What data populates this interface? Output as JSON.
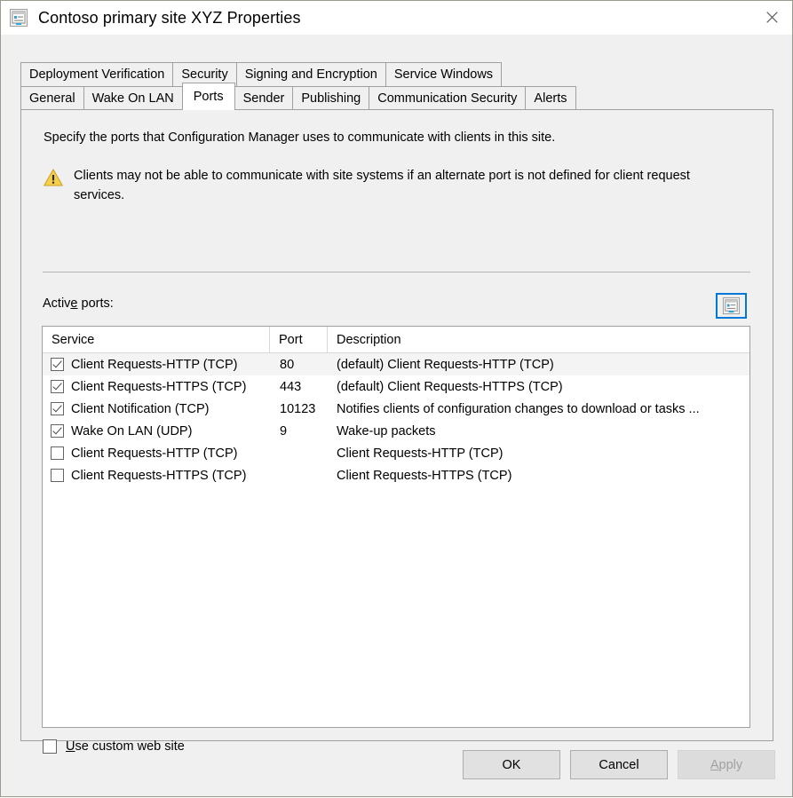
{
  "window": {
    "title": "Contoso primary site XYZ Properties",
    "title_icon": "properties-document-icon",
    "close_icon": "close-icon"
  },
  "tabs": {
    "row1": [
      {
        "label": "Deployment Verification",
        "selected": false
      },
      {
        "label": "Security",
        "selected": false
      },
      {
        "label": "Signing and Encryption",
        "selected": false
      },
      {
        "label": "Service Windows",
        "selected": false
      }
    ],
    "row2": [
      {
        "label": "General",
        "selected": false
      },
      {
        "label": "Wake On LAN",
        "selected": false
      },
      {
        "label": "Ports",
        "selected": true
      },
      {
        "label": "Sender",
        "selected": false
      },
      {
        "label": "Publishing",
        "selected": false
      },
      {
        "label": "Communication Security",
        "selected": false
      },
      {
        "label": "Alerts",
        "selected": false
      }
    ]
  },
  "panel": {
    "intro": "Specify the ports that Configuration Manager uses to communicate with clients in this site.",
    "warning_icon": "warning-triangle-icon",
    "warning": "Clients may not be able to communicate with site systems if an alternate port is not defined for client request services.",
    "active_ports_label_pre": "Activ",
    "active_ports_label_accel": "e",
    "active_ports_label_post": " ports:",
    "properties_button_icon": "properties-document-icon"
  },
  "listview": {
    "columns": [
      "Service",
      "Port",
      "Description"
    ],
    "rows": [
      {
        "checked": true,
        "service": "Client Requests-HTTP (TCP)",
        "port": "80",
        "description": "(default) Client Requests-HTTP (TCP)",
        "highlighted": true
      },
      {
        "checked": true,
        "service": "Client Requests-HTTPS (TCP)",
        "port": "443",
        "description": "(default) Client Requests-HTTPS (TCP)",
        "highlighted": false
      },
      {
        "checked": true,
        "service": "Client Notification (TCP)",
        "port": "10123",
        "description": "Notifies clients of configuration changes to download or tasks ...",
        "highlighted": false
      },
      {
        "checked": true,
        "service": "Wake On LAN (UDP)",
        "port": "9",
        "description": "Wake-up packets",
        "highlighted": false
      },
      {
        "checked": false,
        "service": "Client Requests-HTTP (TCP)",
        "port": "",
        "description": "Client Requests-HTTP (TCP)",
        "highlighted": false
      },
      {
        "checked": false,
        "service": "Client Requests-HTTPS (TCP)",
        "port": "",
        "description": "Client Requests-HTTPS (TCP)",
        "highlighted": false
      }
    ]
  },
  "custom_web_site": {
    "checked": false,
    "label_accel": "U",
    "label_rest": "se custom web site"
  },
  "buttons": {
    "ok": "OK",
    "cancel": "Cancel",
    "apply_accel": "A",
    "apply_rest": "pply",
    "apply_enabled": false
  },
  "colors": {
    "dialog_bg": "#f0f0f0",
    "titlebar_bg": "#ffffff",
    "accent_focus": "#0078d7",
    "warning": "#f5c518",
    "row_alt": "#f4f4f4"
  }
}
